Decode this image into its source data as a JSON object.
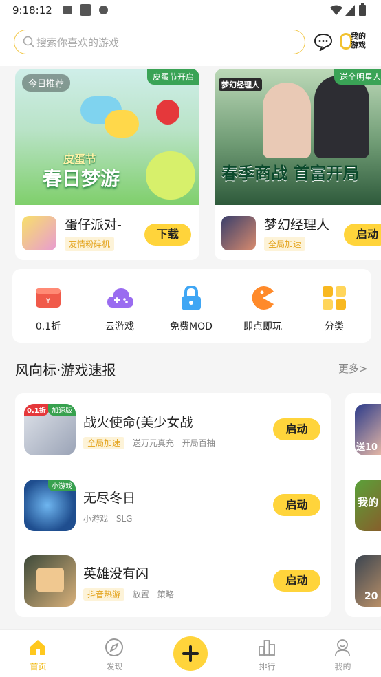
{
  "status_bar": {
    "time": "9:18:12"
  },
  "search": {
    "placeholder": "搜索你喜欢的游戏"
  },
  "header": {
    "my_games_label": "我的游戏"
  },
  "banners": [
    {
      "corner_tag": "皮蛋节开启",
      "today_tag": "今日推荐",
      "art_title": "春日梦游",
      "art_subtitle": "皮蛋节",
      "game_name": "蛋仔派对-",
      "chip": "友情粉碎机",
      "button": "下载"
    },
    {
      "corner_tag": "送全明星人",
      "art_title": "春季商战 首富开局",
      "art_subtitle": "梦幻经理人",
      "game_name": "梦幻经理人",
      "chip": "全局加速",
      "button": "启动"
    }
  ],
  "quick_entries": [
    {
      "label": "0.1折",
      "icon": "coupon-icon"
    },
    {
      "label": "云游戏",
      "icon": "cloud-gamepad-icon"
    },
    {
      "label": "免费MOD",
      "icon": "lock-icon"
    },
    {
      "label": "即点即玩",
      "icon": "pacman-icon"
    },
    {
      "label": "分类",
      "icon": "grid-icon"
    }
  ],
  "section": {
    "title": "风向标·游戏速报",
    "more": "更多>"
  },
  "games": [
    {
      "name": "战火使命(美少女战",
      "badge": "加速版",
      "discount": "0.1折",
      "chip": "全局加速",
      "tags": [
        "送万元真充",
        "开局百抽"
      ],
      "button": "启动"
    },
    {
      "name": "无尽冬日",
      "badge": "小游戏",
      "chip": "",
      "tags": [
        "小游戏",
        "SLG"
      ],
      "button": "启动"
    },
    {
      "name": "英雄没有闪",
      "badge": "",
      "chip": "抖音热游",
      "tags": [
        "放置",
        "策略"
      ],
      "button": "启动"
    }
  ],
  "peek_texts": [
    "送10",
    "我的",
    "20"
  ],
  "bottom_nav": [
    {
      "label": "首页",
      "active": true
    },
    {
      "label": "发现",
      "active": false
    },
    {
      "label": "",
      "active": false
    },
    {
      "label": "排行",
      "active": false
    },
    {
      "label": "我的",
      "active": false
    }
  ],
  "colors": {
    "accent": "#ffd43b",
    "chip_text": "#e3a21a",
    "active_nav": "#f0b400"
  }
}
